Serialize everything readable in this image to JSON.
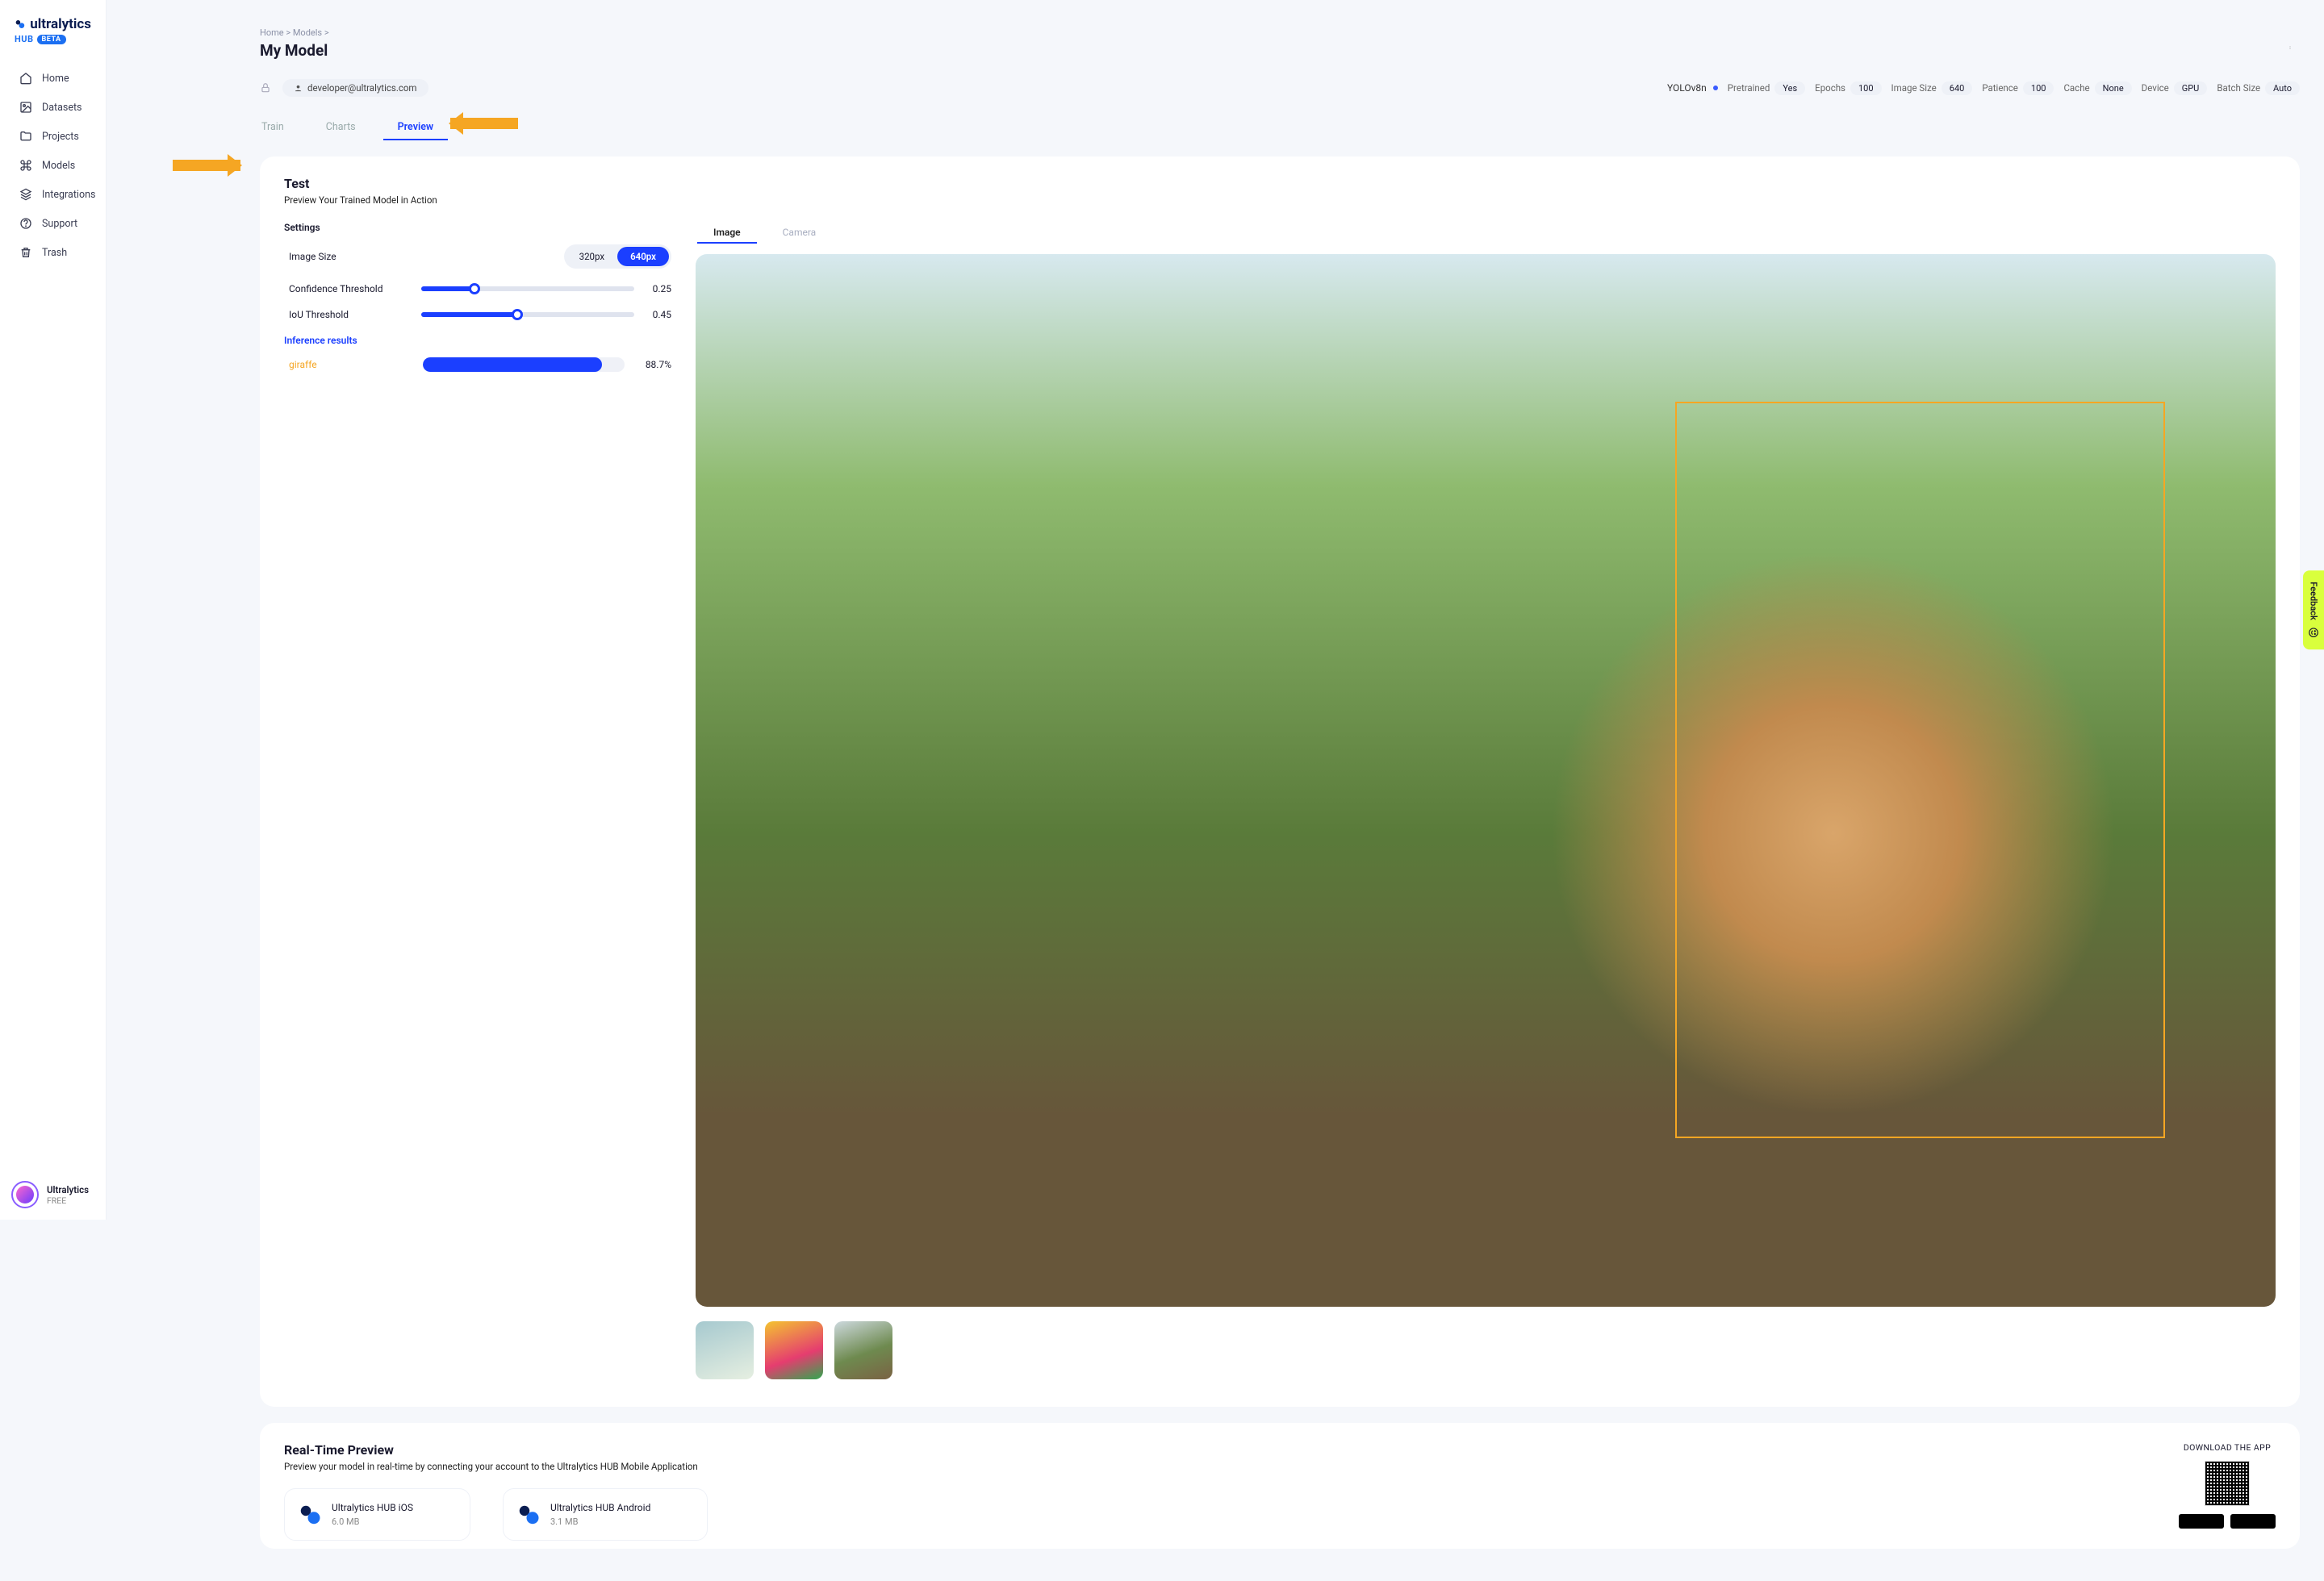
{
  "logo": {
    "brand": "ultralytics",
    "hub": "HUB",
    "beta": "BETA"
  },
  "nav": [
    {
      "label": "Home"
    },
    {
      "label": "Datasets"
    },
    {
      "label": "Projects"
    },
    {
      "label": "Models"
    },
    {
      "label": "Integrations"
    },
    {
      "label": "Support"
    },
    {
      "label": "Trash"
    }
  ],
  "footer": {
    "user": "Ultralytics",
    "plan": "FREE"
  },
  "breadcrumbs": {
    "home": "Home",
    "models": "Models"
  },
  "page_title": "My Model",
  "email": "developer@ultralytics.com",
  "model_name": "YOLOv8n",
  "meta": {
    "pretrained_k": "Pretrained",
    "pretrained_v": "Yes",
    "epochs_k": "Epochs",
    "epochs_v": "100",
    "imgsize_k": "Image Size",
    "imgsize_v": "640",
    "patience_k": "Patience",
    "patience_v": "100",
    "cache_k": "Cache",
    "cache_v": "None",
    "device_k": "Device",
    "device_v": "GPU",
    "batch_k": "Batch Size",
    "batch_v": "Auto"
  },
  "tabs": {
    "train": "Train",
    "charts": "Charts",
    "preview": "Preview"
  },
  "test": {
    "title": "Test",
    "subtitle": "Preview Your Trained Model in Action",
    "settings_h": "Settings",
    "imgsize_lbl": "Image Size",
    "imgsize_opts": {
      "a": "320px",
      "b": "640px"
    },
    "conf_lbl": "Confidence Threshold",
    "conf_val": "0.25",
    "iou_lbl": "IoU Threshold",
    "iou_val": "0.45",
    "results_h": "Inference results",
    "res_class": "giraffe",
    "res_score": "88.7%"
  },
  "img_tabs": {
    "image": "Image",
    "camera": "Camera"
  },
  "realtime": {
    "title": "Real-Time Preview",
    "subtitle": "Preview your model in real-time by connecting your account to the Ultralytics HUB Mobile Application",
    "ios_name": "Ultralytics HUB iOS",
    "ios_size": "6.0 MB",
    "and_name": "Ultralytics HUB Android",
    "and_size": "3.1 MB",
    "download": "DOWNLOAD THE APP"
  },
  "feedback": "Feedback"
}
